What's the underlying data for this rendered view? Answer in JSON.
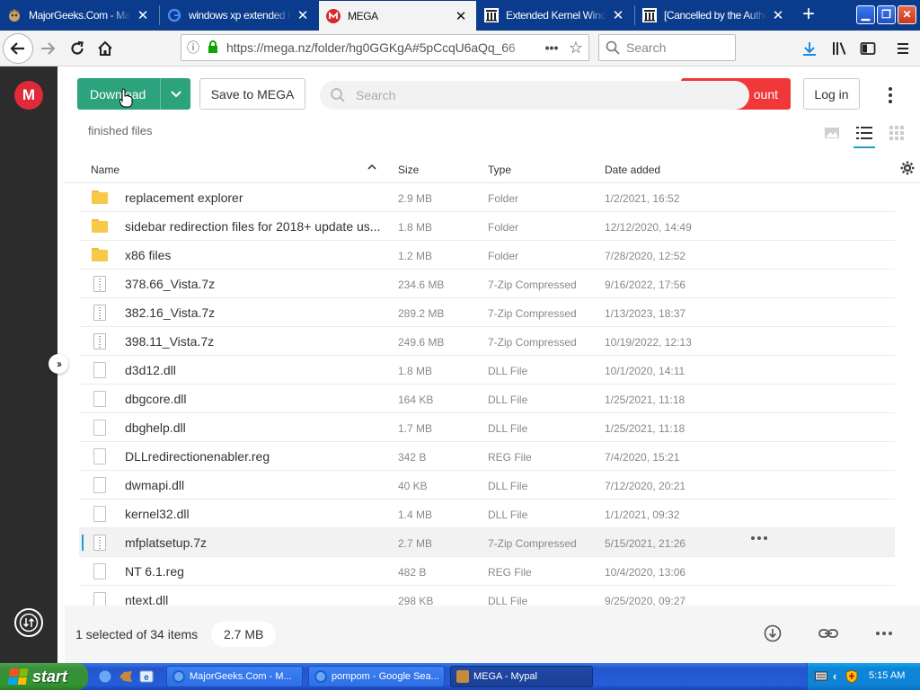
{
  "browser": {
    "tabs": [
      {
        "title": "MajorGeeks.Com - Major",
        "active": false,
        "icon": "majorgeeks-icon"
      },
      {
        "title": "windows xp extended ke",
        "active": false,
        "icon": "google-icon"
      },
      {
        "title": "MEGA",
        "active": true,
        "icon": "mega-icon"
      },
      {
        "title": "Extended Kernel Windo",
        "active": false,
        "icon": "columns-icon"
      },
      {
        "title": "[Cancelled by the Author",
        "active": false,
        "icon": "columns-icon"
      }
    ],
    "url": "https://mega.nz/folder/hg0GGKgA#5pCcqU6aQq_66",
    "search_placeholder": "Search"
  },
  "mega": {
    "download_label": "Download",
    "save_label": "Save to MEGA",
    "create_account_label": "ount",
    "search_placeholder": "Search",
    "login_label": "Log in",
    "breadcrumb": "finished files",
    "columns": {
      "name": "Name",
      "size": "Size",
      "type": "Type",
      "date": "Date added"
    },
    "files": [
      {
        "name": "replacement explorer",
        "size": "2.9 MB",
        "type": "Folder",
        "date": "1/2/2021, 16:52",
        "kind": "folder"
      },
      {
        "name": "sidebar redirection files for 2018+ update us...",
        "size": "1.8 MB",
        "type": "Folder",
        "date": "12/12/2020, 14:49",
        "kind": "folder"
      },
      {
        "name": "x86 files",
        "size": "1.2 MB",
        "type": "Folder",
        "date": "7/28/2020, 12:52",
        "kind": "folder"
      },
      {
        "name": "378.66_Vista.7z",
        "size": "234.6 MB",
        "type": "7-Zip Compressed",
        "date": "9/16/2022, 17:56",
        "kind": "archive"
      },
      {
        "name": "382.16_Vista.7z",
        "size": "289.2 MB",
        "type": "7-Zip Compressed",
        "date": "1/13/2023, 18:37",
        "kind": "archive"
      },
      {
        "name": "398.11_Vista.7z",
        "size": "249.6 MB",
        "type": "7-Zip Compressed",
        "date": "10/19/2022, 12:13",
        "kind": "archive"
      },
      {
        "name": "d3d12.dll",
        "size": "1.8 MB",
        "type": "DLL File",
        "date": "10/1/2020, 14:11",
        "kind": "generic"
      },
      {
        "name": "dbgcore.dll",
        "size": "164 KB",
        "type": "DLL File",
        "date": "1/25/2021, 11:18",
        "kind": "generic"
      },
      {
        "name": "dbghelp.dll",
        "size": "1.7 MB",
        "type": "DLL File",
        "date": "1/25/2021, 11:18",
        "kind": "generic"
      },
      {
        "name": "DLLredirectionenabler.reg",
        "size": "342 B",
        "type": "REG File",
        "date": "7/4/2020, 15:21",
        "kind": "generic"
      },
      {
        "name": "dwmapi.dll",
        "size": "40 KB",
        "type": "DLL File",
        "date": "7/12/2020, 20:21",
        "kind": "generic"
      },
      {
        "name": "kernel32.dll",
        "size": "1.4 MB",
        "type": "DLL File",
        "date": "1/1/2021, 09:32",
        "kind": "generic"
      },
      {
        "name": "mfplatsetup.7z",
        "size": "2.7 MB",
        "type": "7-Zip Compressed",
        "date": "5/15/2021, 21:26",
        "kind": "archive",
        "selected": true
      },
      {
        "name": "NT 6.1.reg",
        "size": "482 B",
        "type": "REG File",
        "date": "10/4/2020, 13:06",
        "kind": "generic"
      },
      {
        "name": "ntext.dll",
        "size": "298 KB",
        "type": "DLL File",
        "date": "9/25/2020, 09:27",
        "kind": "generic"
      }
    ],
    "selection_text": "1 selected of 34 items",
    "selection_size": "2.7 MB"
  },
  "taskbar": {
    "start_label": "start",
    "buttons": [
      {
        "label": "MajorGeeks.Com - M...",
        "active": false
      },
      {
        "label": "pompom - Google Sea...",
        "active": false
      },
      {
        "label": "MEGA - Mypal",
        "active": true
      }
    ],
    "clock": "5:15 AM"
  },
  "colors": {
    "download_green": "#2ca37c",
    "create_account_red": "#f0373a",
    "mega_red": "#e02a39",
    "selection_blue": "#1e9bdc",
    "xp_blue": "#245ddb",
    "xp_start_green": "#3a8f3a",
    "firefox_tabstrip": "#0a3b8c"
  }
}
